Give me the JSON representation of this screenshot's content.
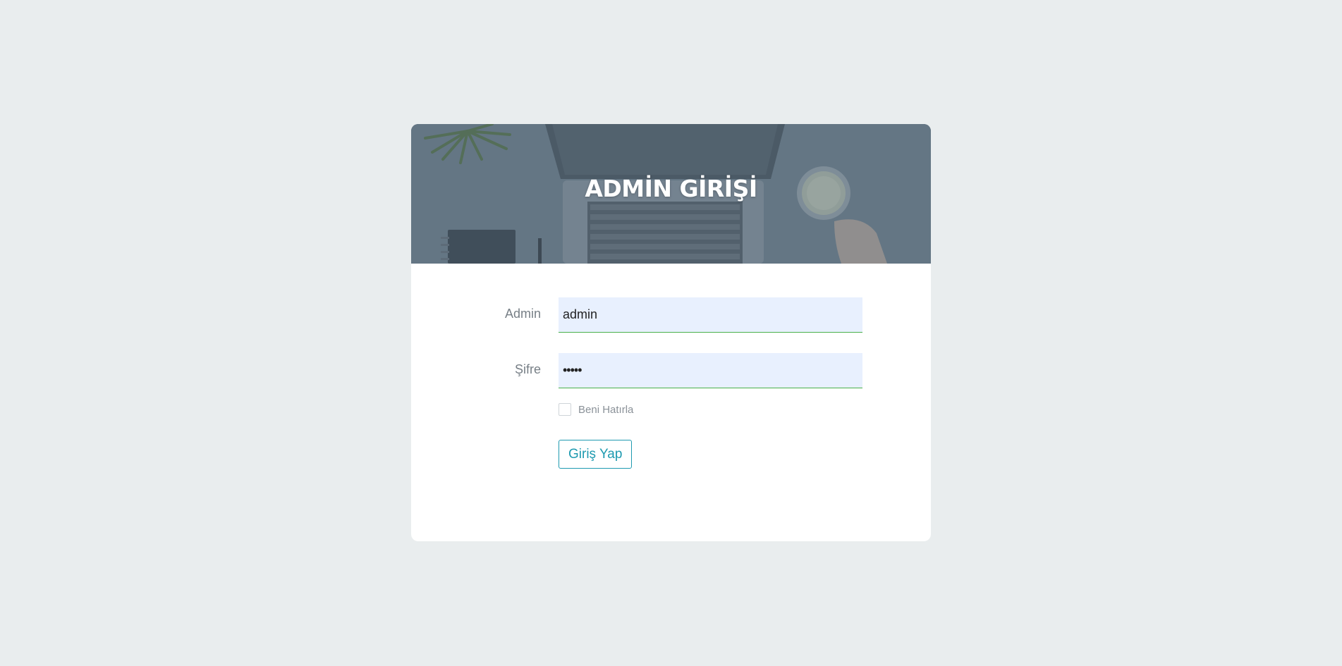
{
  "header": {
    "title": "ADMİN GİRİŞİ"
  },
  "form": {
    "username_label": "Admin",
    "username_value": "admin",
    "password_label": "Şifre",
    "password_value": "•••••",
    "remember_label": "Beni Hatırla",
    "remember_checked": false,
    "submit_label": "Giriş Yap"
  },
  "colors": {
    "page_background": "#e9edee",
    "accent": "#1e9ab0",
    "input_underline": "#49b04a",
    "input_background": "#e8f0fe"
  }
}
